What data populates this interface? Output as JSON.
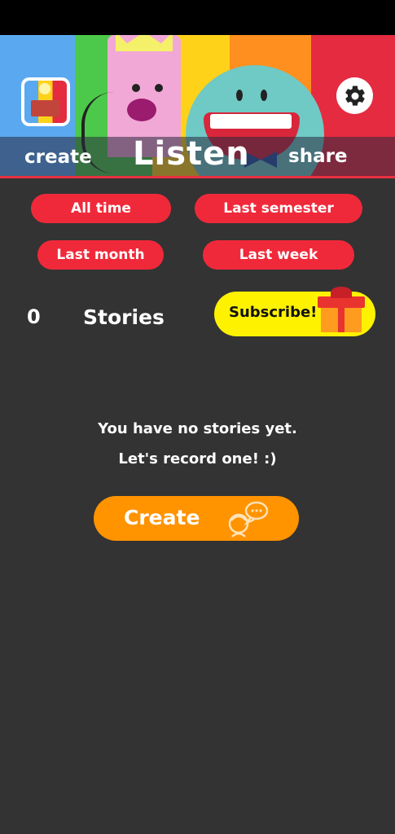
{
  "header": {
    "tabs": {
      "create": "create",
      "listen": "Listen",
      "share": "share"
    }
  },
  "filters": {
    "all_time": "All time",
    "last_semester": "Last semester",
    "last_month": "Last month",
    "last_week": "Last week"
  },
  "stats": {
    "count": "0",
    "label": "Stories"
  },
  "subscribe": {
    "label": "Subscribe!"
  },
  "empty_state": {
    "line1": "You have no stories yet.",
    "line2": "Let's record one! :)"
  },
  "create_button": {
    "label": "Create"
  },
  "colors": {
    "accent_red": "#f0293a",
    "accent_orange": "#ff9300",
    "subscribe_yellow": "#fff200",
    "background": "#333333"
  }
}
